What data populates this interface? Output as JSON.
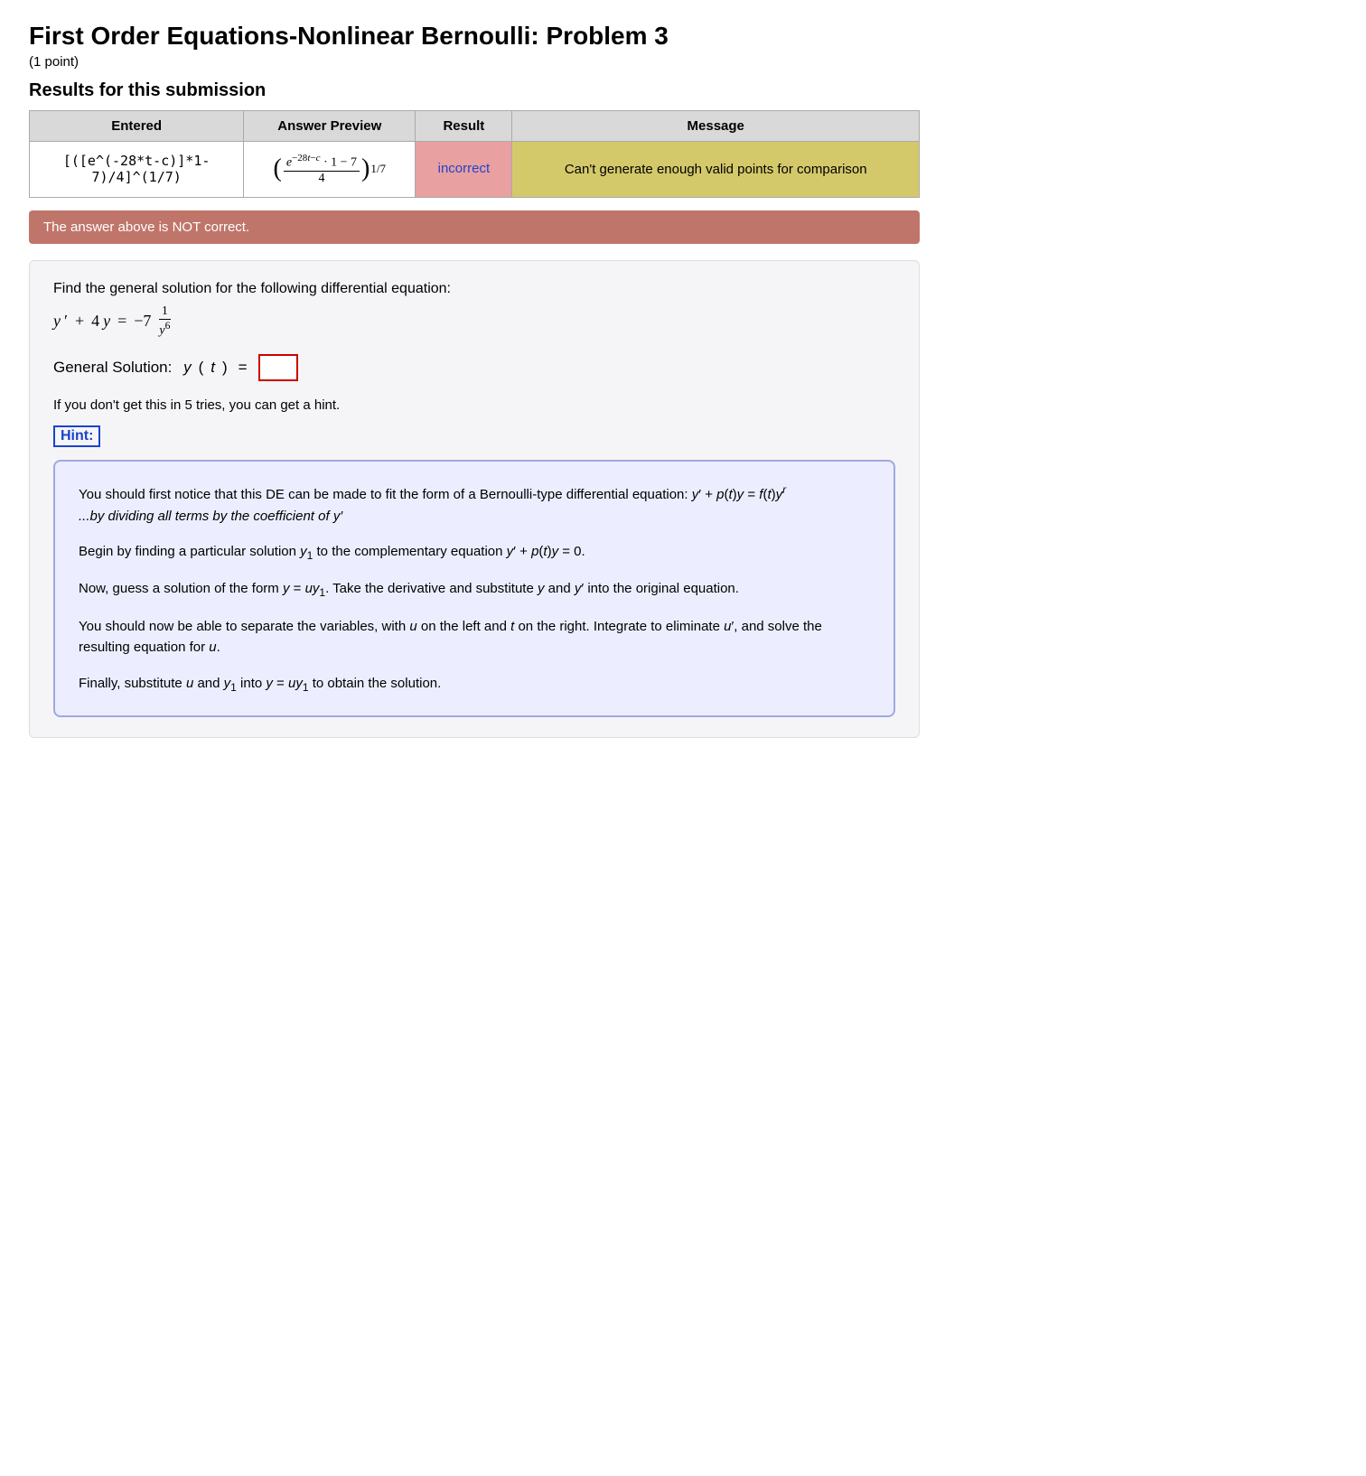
{
  "page": {
    "title": "First Order Equations-Nonlinear Bernoulli: Problem 3",
    "points": "(1 point)",
    "results_heading": "Results for this submission"
  },
  "table": {
    "headers": [
      "Entered",
      "Answer Preview",
      "Result",
      "Message"
    ],
    "row": {
      "entered": "[([ e^(-28*t-c)]*1-7)/4]^(1/7)",
      "result": "incorrect",
      "message": "Can't generate enough valid points for comparison"
    }
  },
  "not_correct": "The answer above is NOT correct.",
  "problem": {
    "description": "Find the general solution for the following differential equation:",
    "general_solution_label": "General Solution:",
    "y_of_t": "y(t) =",
    "tries_text": "If you don't get this in 5 tries, you can get a hint."
  },
  "hint": {
    "label": "Hint:",
    "paragraphs": [
      "You should first notice that this DE can be made to fit the form of a Bernoulli-type differential equation: y′ + p(t)y = f(t)yⁿ",
      "...by dividing all terms by the coefficient of y′",
      "Begin by finding a particular solution y₁ to the complementary equation y′ + p(t)y = 0.",
      "Now, guess a solution of the form y = uy₁. Take the derivative and substitute y and y′ into the original equation.",
      "You should now be able to separate the variables, with u on the left and t on the right. Integrate to eliminate u′, and solve the resulting equation for u.",
      "Finally, substitute u and y₁ into y = uy₁ to obtain the solution."
    ]
  }
}
